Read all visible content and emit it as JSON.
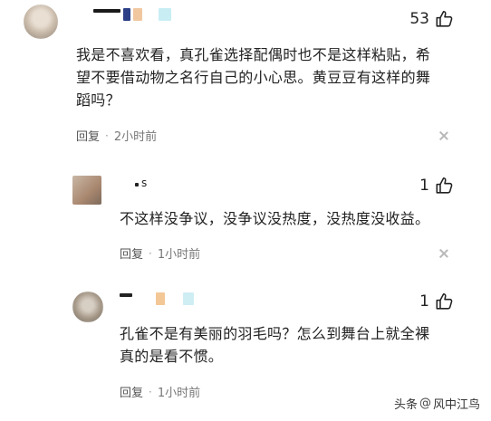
{
  "comments": [
    {
      "likes": "53",
      "text_lines": [
        "我是不喜欢看，真孔雀选择配偶时也不是这样粘贴，希",
        "望不要借动物之名行自己的小心思。黄豆豆有这样的舞",
        "蹈吗？"
      ],
      "reply_label": "回复",
      "separator": "·",
      "time": "2小时前"
    },
    {
      "nickname_tail": "s",
      "likes": "1",
      "text_lines": [
        "不这样没争议，没争议没热度，没热度没收益。"
      ],
      "reply_label": "回复",
      "separator": "·",
      "time": "1小时前"
    },
    {
      "likes": "1",
      "text_lines": [
        "孔雀不是有美丽的羽毛吗？怎么到舞台上就全裸",
        "真的是看不惯。"
      ],
      "reply_label": "回复",
      "separator": "·",
      "time": "1小时前"
    }
  ],
  "watermark": {
    "prefix": "头条",
    "at": "@",
    "author": "风中江鸟"
  },
  "icons": {
    "like": "thumbs-up-icon",
    "dismiss": "close-icon"
  },
  "colors": {
    "text": "#222222",
    "meta": "#777777",
    "background": "#ffffff"
  }
}
